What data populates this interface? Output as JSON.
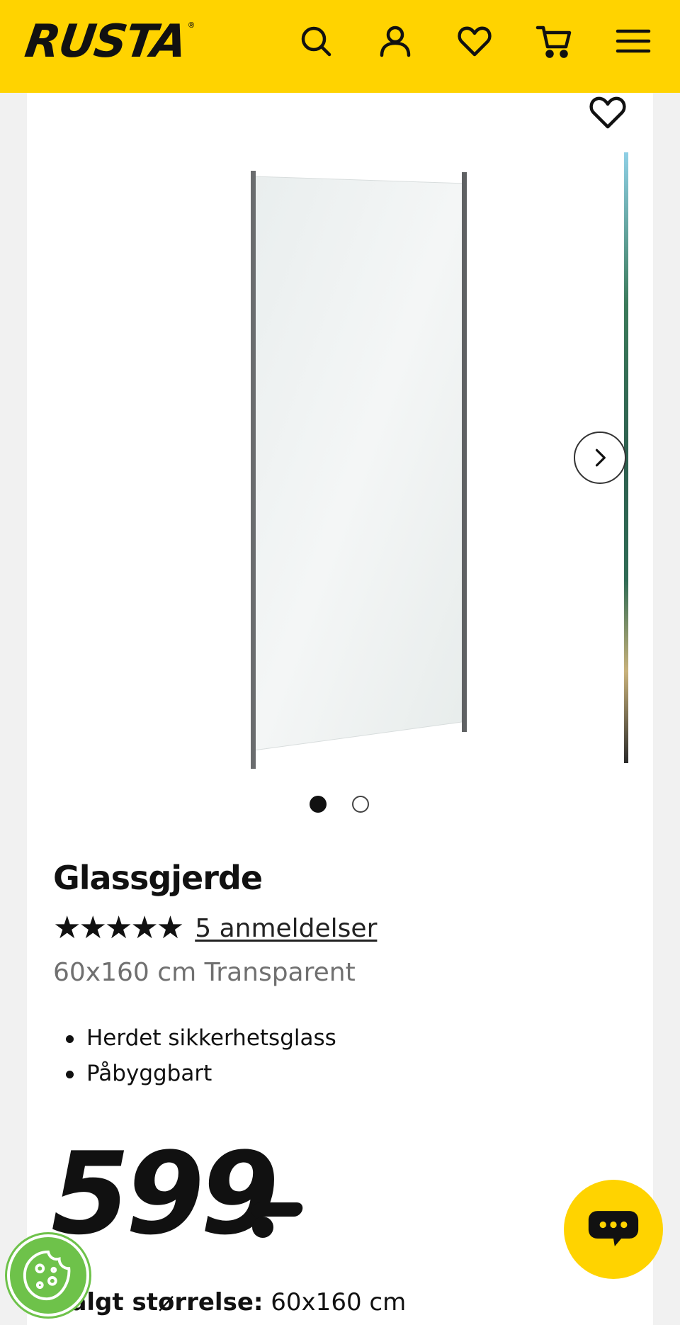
{
  "header": {
    "logo_text": "RUSTA",
    "logo_mark": "®",
    "brand_color": "#ffd300",
    "icons": [
      "search-icon",
      "account-icon",
      "wishlist-icon",
      "cart-icon",
      "menu-icon"
    ]
  },
  "gallery": {
    "image_count": 2,
    "active_index": 0
  },
  "product": {
    "title": "Glassgjerde",
    "stars": "★★★★★",
    "rating": 5,
    "reviews_label": "5 anmeldelser",
    "subtitle": "60x160 cm Transparent",
    "features": [
      "Herdet sikkerhetsglass",
      "Påbyggbart"
    ],
    "price": "599"
  },
  "size": {
    "label": "Valgt størrelse:",
    "value": "60x160 cm"
  }
}
